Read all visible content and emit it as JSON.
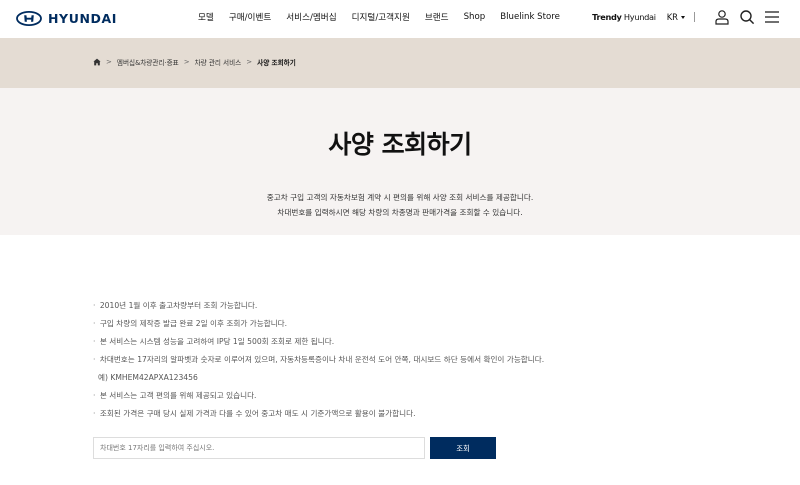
{
  "header": {
    "logo_text": "HYUNDAI",
    "menu": [
      "모델",
      "구매/이벤트",
      "서비스/멤버십",
      "디지털/고객지원",
      "브랜드",
      "Shop",
      "Bluelink Store"
    ],
    "trendy_bold": "Trendy",
    "trendy_rest": " Hyundai",
    "lang": "KR",
    "icons": [
      "user-icon",
      "search-icon",
      "hamburger-menu-icon"
    ],
    "brand_color": "#002c5f"
  },
  "breadcrumb": {
    "home_icon": "home-icon",
    "items": [
      "멤버십&차량관리·증표",
      "차량 관리 서비스",
      "사양 조회하기"
    ],
    "separator": ">",
    "band_color": "#e4dcd3"
  },
  "hero": {
    "title": "사양 조회하기",
    "desc_line1": "중고차 구입 고객의 자동차보험 계약 시 편의를 위해 사양 조회 서비스를 제공합니다.",
    "desc_line2": "차대번호를 입력하시면 해당 차량의 차종명과 판매가격을 조회할 수 있습니다.",
    "bg_color": "#f6f3f2"
  },
  "notices": {
    "bullet": "·",
    "items": [
      "2010년 1월 이후 출고차량부터 조회 가능합니다.",
      "구입 차량의 제작증 발급 완료 2일 이후 조회가 가능합니다.",
      "본 서비스는 시스템 성능을 고려하여 IP당 1일 500회 조회로 제한 됩니다.",
      "차대번호는 17자리의 알파벳과 숫자로 이루어져 있으며, 자동차등록증이나 차내 운전석 도어 안쪽, 대시보드 하단 등에서 확인이 가능합니다.",
      "본 서비스는 고객 편의를 위해 제공되고 있습니다.",
      "조회된 가격은 구매 당시 실제 가격과 다를 수 있어 중고차 매도 시 기준가액으로 활용이 불가합니다."
    ],
    "example": "예) KMHEM42APXA123456"
  },
  "search": {
    "placeholder": "차대번호 17자리를 입력하여 주십시오.",
    "value": "",
    "button_label": "조회"
  }
}
